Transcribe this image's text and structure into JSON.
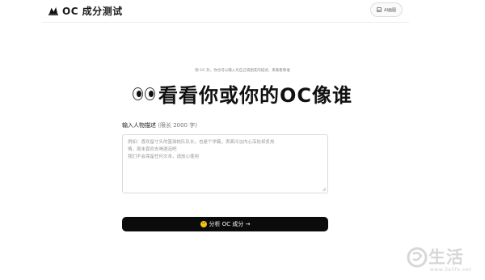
{
  "header": {
    "app_title": "OC 成分测试",
    "ai_button_label": "AI画图"
  },
  "notice": "限 OC 卦，你也可以输入对自己或朋友的描述，来看看像谁",
  "hero": {
    "title": "看看你或你的OC像谁",
    "emoji": "eyes"
  },
  "form": {
    "label": "输入人物描述",
    "limit_hint": "(限长 2000 字)",
    "placeholder_lines": [
      "例如：喜欢留寸头的篮球校队队长，也是个学霸，表面冷淡内心深处却炙热",
      "情，周末喜欢去喝酒泡吧",
      "",
      "我们不会保留任何文本，请放心使用"
    ],
    "submit_label": "分析 OC 成分 →"
  },
  "watermark": {
    "text": "生活",
    "url": "www.3elife.net"
  }
}
